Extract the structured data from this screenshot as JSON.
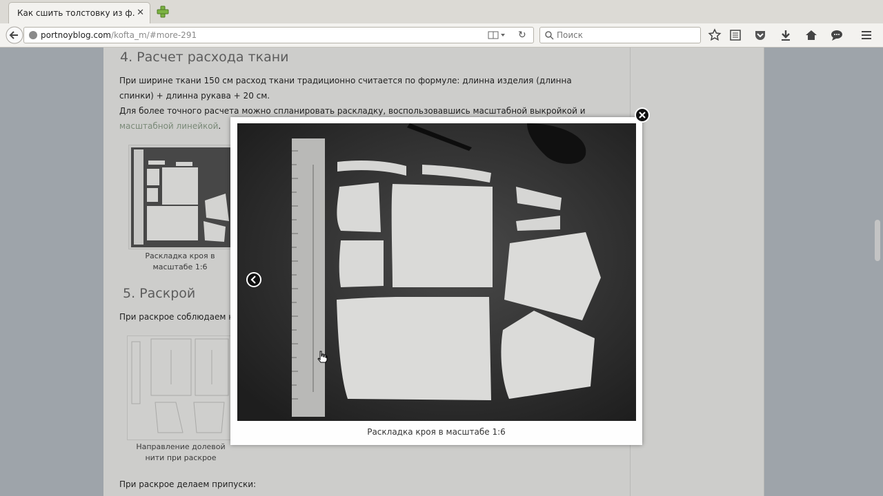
{
  "browser": {
    "tab_title": "Как сшить толстовку из ф…",
    "tab_close": "✕",
    "url_host": "portnoyblog.com",
    "url_path": "/kofta_m/#more-291",
    "search_placeholder": "Поиск",
    "toolbar_icons": [
      "bookmark-star-icon",
      "reading-list-icon",
      "pocket-icon",
      "download-icon",
      "home-icon",
      "chat-icon",
      "menu-icon"
    ]
  },
  "article": {
    "section4_title": "4. Расчет расхода ткани",
    "section4_p1": "При ширине ткани 150 см расход ткани традиционно считается по формуле: длинна изделия (длинна спинки) + длинна рукава + 20 см.",
    "section4_p2_text": "Для более точного расчета можно спланировать раскладку, воспользовавшись масштабной выкройкой и ",
    "section4_p2_link": "масштабной линейкой",
    "section4_p2_end": ".",
    "thumb1_caption": "Раскладка кроя в масштабе 1:6",
    "section5_title": "5. Раскрой",
    "section5_p1": "При раскрое соблюдаем нап",
    "thumb2_caption": "Направление долевой нити при раскрое",
    "allowances_text": "При раскрое делаем припуски:"
  },
  "lightbox": {
    "caption": "Раскладка кроя в масштабе 1:6",
    "close_icon": "close-icon",
    "prev_icon": "chevron-left-icon"
  },
  "colors": {
    "overlay_page": "#cdcdcb",
    "link": "#7a8a78",
    "lightbox_bg": "#fefefe"
  }
}
